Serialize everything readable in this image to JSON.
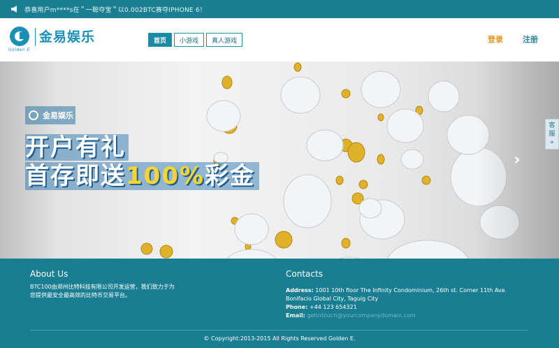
{
  "topbar": {
    "icon": "megaphone-icon",
    "notice": "恭喜用户m****s在＂一聪夺宝＂以0.002BTC赛夺IPHONE 6！"
  },
  "header": {
    "logo_text": "金易娱乐",
    "logo_sub": "Golden E",
    "nav": [
      {
        "label": "首页",
        "active": true
      },
      {
        "label": "小游戏",
        "active": false
      },
      {
        "label": "真人游戏",
        "active": false
      }
    ],
    "login": "登录",
    "register": "注册"
  },
  "banner": {
    "brand": "金易娱乐",
    "headline1": "开户有礼",
    "headline2_prefix": "首存即送",
    "headline2_highlight": "100%",
    "headline2_suffix": "彩金",
    "next_arrow": "›"
  },
  "side_service": {
    "label_line1": "客",
    "label_line2": "服",
    "icon": "»"
  },
  "footer": {
    "about_title": "About Us",
    "about_text_line1": "BTC100由郑州比特科技有限公司开发运营，我们致力于为",
    "about_text_line2": "您提供最安全最高效的比特币交易平台。",
    "contacts_title": "Contacts",
    "address_label": "Address:",
    "address_value": "1001 10th floor The Infinity Condominium, 26th st. Corner 11th Ave. Bonifacio Global City, Taguig City",
    "phone_label": "Phone:",
    "phone_value": "+44 123 654321",
    "email_label": "Email:",
    "email_value": "getintouch@yourcompanydomain.com",
    "copyright": "© Copyright:2013-2015 All Rights Reserved Golden E."
  },
  "colors": {
    "teal": "#1a7e92",
    "accent_orange": "#e8951a",
    "brand_blue": "#1a90b6",
    "highlight_yellow": "#f6d530"
  }
}
